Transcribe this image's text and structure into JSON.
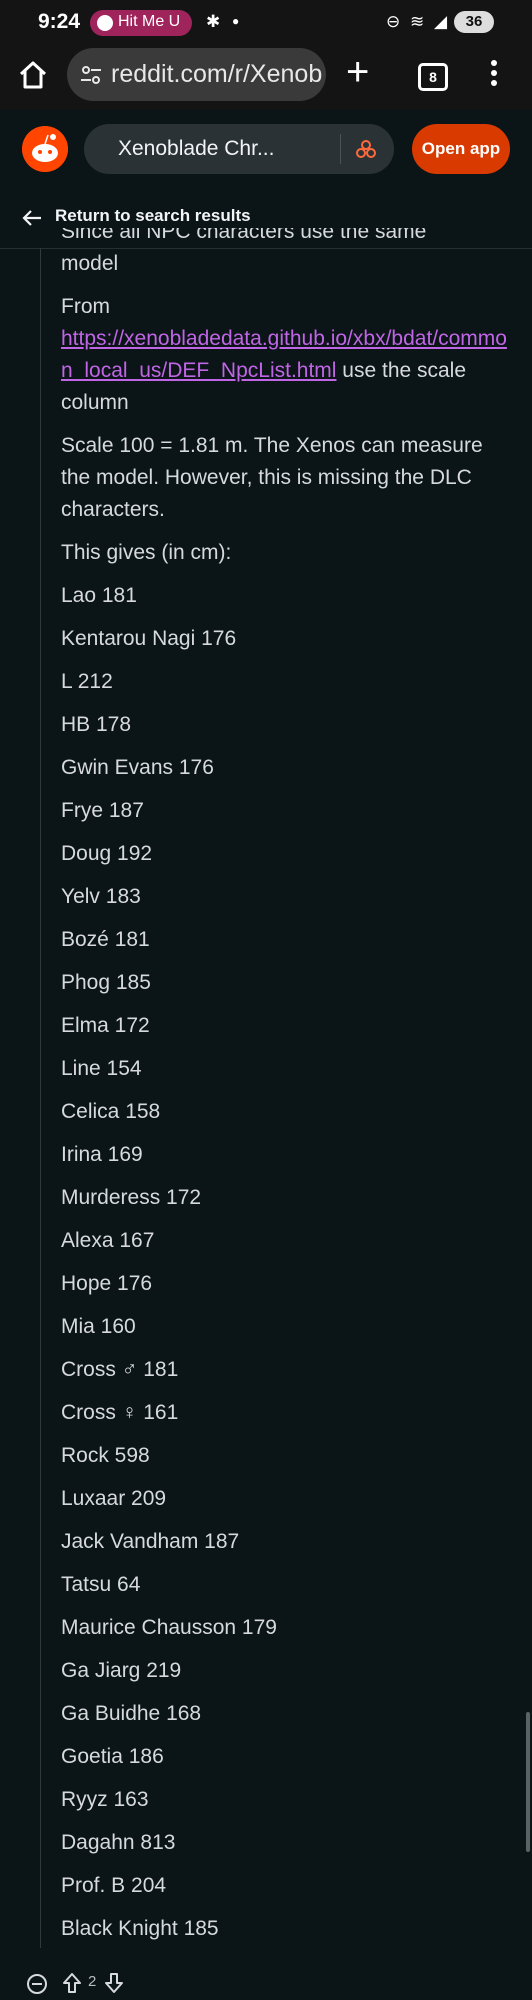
{
  "status_bar": {
    "time": "9:24",
    "spotify_label": "Hit Me U",
    "battery": "36"
  },
  "browser": {
    "url": "reddit.com/r/Xenob",
    "tab_count": "8"
  },
  "reddit_header": {
    "subreddit": "Xenoblade Chr...",
    "open_app": "Open app"
  },
  "nav": {
    "back_label": "Return to search results"
  },
  "comment": {
    "clipped_line": "Since all NPC characters use the same",
    "para1": "model",
    "from_label": "From",
    "link": "https://xenobladedata.github.io/xbx/bdat/common_local_us/DEF_NpcList.html",
    "link_suffix": " use the scale column",
    "para3": "Scale 100 = 1.81 m. The Xenos can measure the model. However, this is missing the DLC characters.",
    "para4": "This gives (in cm):",
    "lines": [
      "Lao 181",
      "Kentarou Nagi 176",
      "L 212",
      "HB 178",
      "Gwin Evans 176",
      "Frye 187",
      "Doug 192",
      "Yelv 183",
      "Bozé 181",
      "Phog 185",
      "Elma 172",
      "Line 154",
      "Celica 158",
      "Irina 169",
      "Murderess 172",
      "Alexa 167",
      "Hope 176",
      "Mia 160",
      "Cross ♂ 181",
      "Cross ♀ 161",
      "Rock 598",
      "Luxaar 209",
      "Jack Vandham 187",
      "Tatsu 64",
      "Maurice Chausson 179",
      "Ga Jiarg 219",
      "Ga Buidhe 168",
      "Goetia 186",
      "Ryyz 163",
      "Dagahn 813",
      "Prof. B 204",
      "Black Knight 185"
    ],
    "score": "2"
  },
  "colors": {
    "background": "#0b1416",
    "link": "#c065e6",
    "accent": "#d93a00"
  }
}
